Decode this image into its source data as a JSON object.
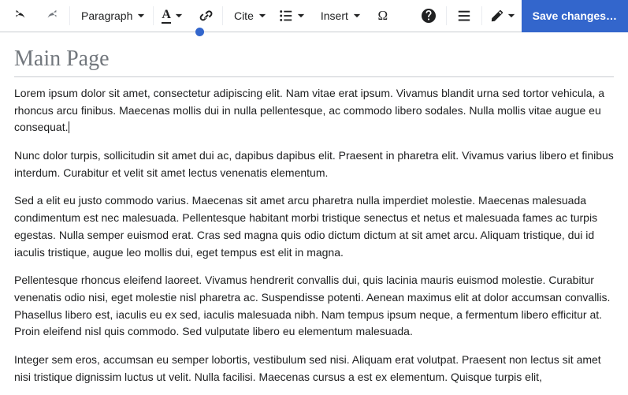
{
  "toolbar": {
    "format_label": "Paragraph",
    "cite_label": "Cite",
    "insert_label": "Insert",
    "special_char": "Ω",
    "save_label": "Save changes…",
    "style_glyph": "A"
  },
  "page": {
    "title": "Main Page",
    "paragraphs": [
      "Lorem ipsum dolor sit amet, consectetur adipiscing elit. Nam vitae erat ipsum. Vivamus blandit urna sed tortor vehicula, a rhoncus arcu finibus. Maecenas mollis dui in nulla pellentesque, ac commodo libero sodales. Nulla mollis vitae augue eu consequat.",
      "Nunc dolor turpis, sollicitudin sit amet dui ac, dapibus dapibus elit. Praesent in pharetra elit. Vivamus varius libero et finibus interdum. Curabitur et velit sit amet lectus venenatis elementum.",
      "Sed a elit eu justo commodo varius. Maecenas sit amet arcu pharetra nulla imperdiet molestie. Maecenas malesuada condimentum est nec malesuada. Pellentesque habitant morbi tristique senectus et netus et malesuada fames ac turpis egestas. Nulla semper euismod erat. Cras sed magna quis odio dictum dictum at sit amet arcu. Aliquam tristique, dui id iaculis tristique, augue leo mollis dui, eget tempus est elit in magna.",
      "Pellentesque rhoncus eleifend laoreet. Vivamus hendrerit convallis dui, quis lacinia mauris euismod molestie. Curabitur venenatis odio nisi, eget molestie nisl pharetra ac. Suspendisse potenti. Aenean maximus elit at dolor accumsan convallis. Phasellus libero est, iaculis eu ex sed, iaculis malesuada nibh. Nam tempus ipsum neque, a fermentum libero efficitur at. Proin eleifend nisl quis commodo. Sed vulputate libero eu elementum malesuada.",
      "Integer sem eros, accumsan eu semper lobortis, vestibulum sed nisi. Aliquam erat volutpat. Praesent non lectus sit amet nisi tristique dignissim luctus ut velit. Nulla facilisi. Maecenas cursus a est ex elementum. Quisque turpis elit,"
    ]
  }
}
